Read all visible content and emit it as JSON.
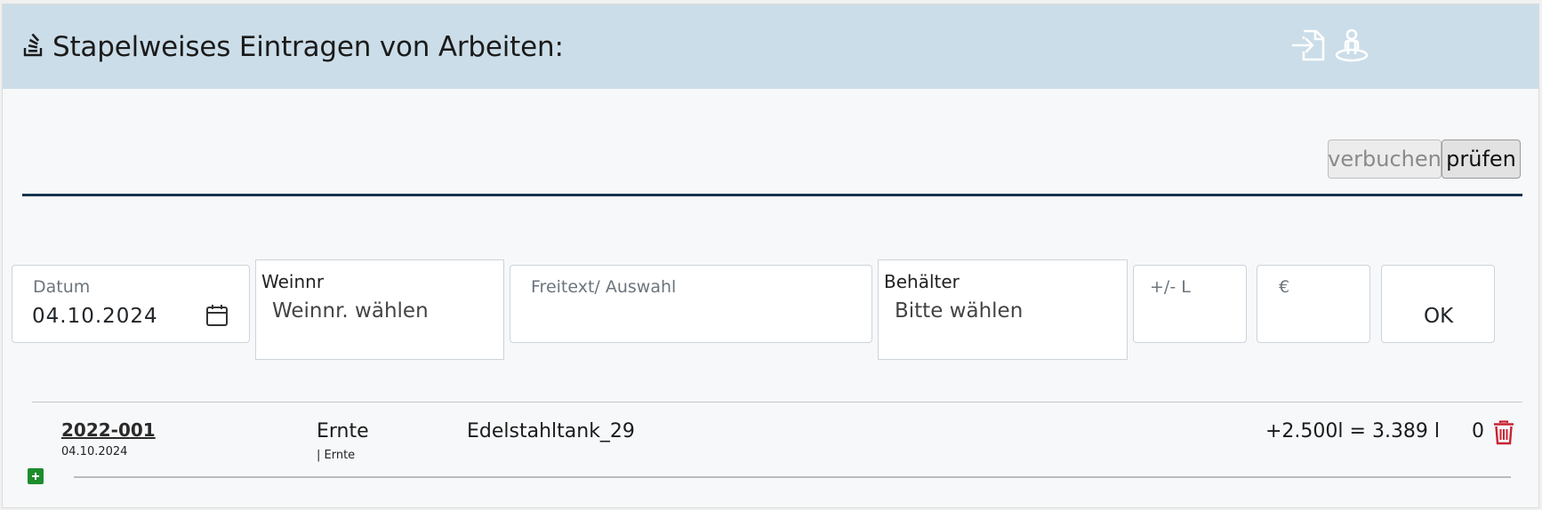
{
  "header": {
    "title": "Stapelweises Eintragen von Arbeiten:",
    "icons": [
      "stack-icon",
      "file-import-icon",
      "person-location-icon"
    ]
  },
  "actions": {
    "verbuchen_label": "verbuchen",
    "pruefen_label": "prüfen"
  },
  "form": {
    "datum_label": "Datum",
    "datum_value": "04.10.2024",
    "weinnr_label": "Weinnr",
    "weinnr_placeholder": "Weinnr. wählen",
    "freitext_label": "Freitext/ Auswahl",
    "behaelter_label": "Behälter",
    "behaelter_placeholder": "Bitte wählen",
    "liter_label": "+/- L",
    "euro_label": "€",
    "ok_label": "OK"
  },
  "entries": [
    {
      "weinnr": "2022-001",
      "date": "04.10.2024",
      "work": "Ernte",
      "work_sub": "| Ernte",
      "container": "Edelstahltank_29",
      "volume": "+2.500l = 3.389 l",
      "price": "0"
    }
  ],
  "colors": {
    "header_bg": "#cbdde8",
    "divider": "#17324d",
    "delete": "#c82333",
    "add": "#1e8c2d"
  }
}
